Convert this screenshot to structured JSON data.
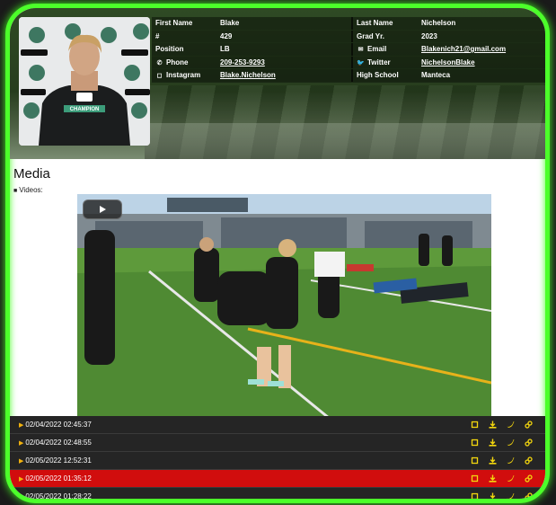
{
  "profile": {
    "first_name_label": "First Name",
    "first_name": "Blake",
    "last_name_label": "Last Name",
    "last_name": "Nichelson",
    "number_label": "#",
    "number": "429",
    "grad_label": "Grad Yr.",
    "grad_year": "2023",
    "position_label": "Position",
    "position": "LB",
    "email_label": "Email",
    "email": "Blakenich21@gmail.com",
    "phone_label": "Phone",
    "phone": "209-253-9293",
    "twitter_label": "Twitter",
    "twitter": "NichelsonBlake",
    "instagram_label": "Instagram",
    "instagram": "Blake.Nichelson",
    "school_label": "High School",
    "school": "Manteca"
  },
  "media": {
    "title": "Media",
    "videos_label": "Videos:"
  },
  "videos": [
    {
      "date": "02/04/2022 02:45:37",
      "active": false
    },
    {
      "date": "02/04/2022 02:48:55",
      "active": false
    },
    {
      "date": "02/05/2022 12:52:31",
      "active": false
    },
    {
      "date": "02/05/2022 01:35:12",
      "active": true
    },
    {
      "date": "02/05/2022 01:28:22",
      "active": false
    }
  ],
  "colors": {
    "accent_border": "#4cff2a",
    "action_icon": "#f3d60e",
    "active_row": "#d10d0d"
  }
}
